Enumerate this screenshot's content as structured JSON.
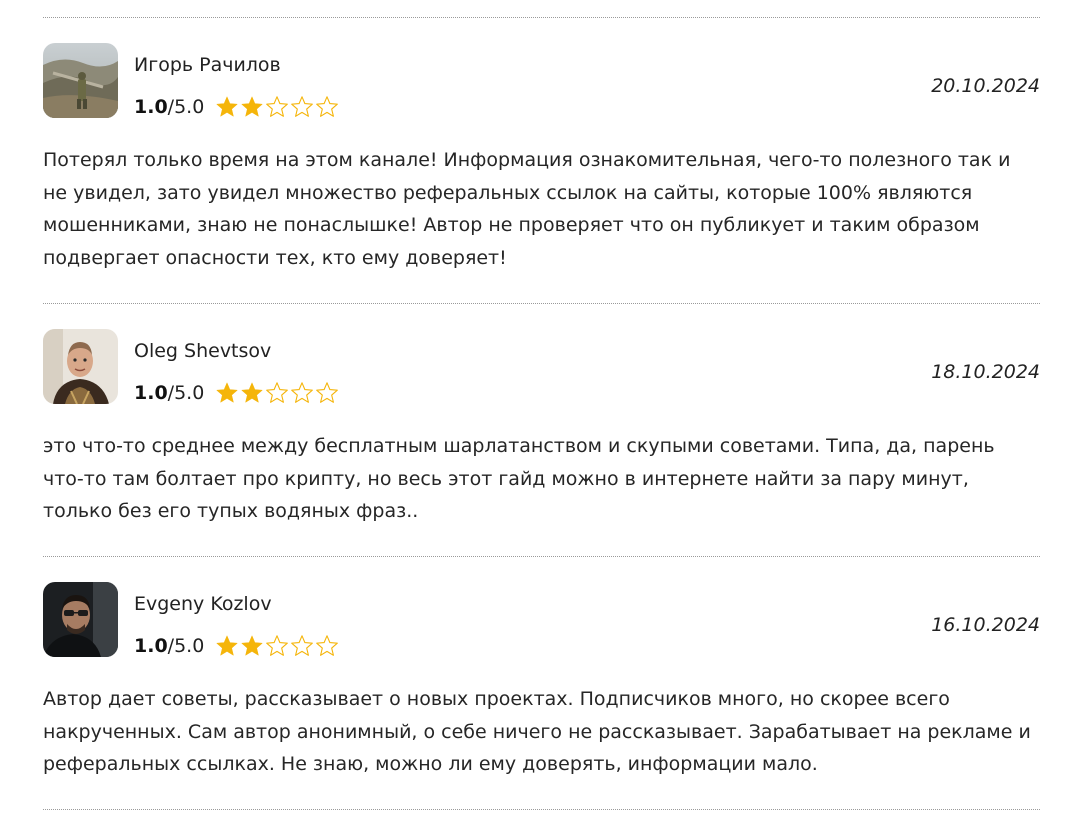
{
  "reviews": [
    {
      "avatar": "photo-person-in-field",
      "name": "Игорь Рачилов",
      "score": "1.0",
      "scale": "/5.0",
      "stars_filled": 2,
      "stars_total": 5,
      "date": "20.10.2024",
      "text": "Потерял только время на этом канале! Информация ознакомительная, чего-то полезного так и не увидел, зато увидел множество реферальных ссылок на сайты, которые 100% являются мошенниками, знаю не понаслышке! Автор не проверяет что он публикует и таким образом подвергает опасности тех, кто ему доверяет!"
    },
    {
      "avatar": "photo-man-portrait",
      "name": "Oleg Shevtsov",
      "score": "1.0",
      "scale": "/5.0",
      "stars_filled": 2,
      "stars_total": 5,
      "date": "18.10.2024",
      "text": "это что-то среднее между бесплатным шарлатанством и скупыми советами. Типа, да, парень что-то там болтает про крипту, но весь этот гайд можно в интернете найти за пару минут, только без его тупых водяных фраз.."
    },
    {
      "avatar": "photo-man-sunglasses",
      "name": "Evgeny Kozlov",
      "score": "1.0",
      "scale": "/5.0",
      "stars_filled": 2,
      "stars_total": 5,
      "date": "16.10.2024",
      "text": "Автор дает советы, рассказывает о новых проектах. Подписчиков много, но скорее всего накрученных. Сам автор анонимный, о себе ничего не рассказывает. Зарабатывает на рекламе и реферальных ссылках. Не знаю, можно ли ему доверять, информации мало."
    }
  ],
  "colors": {
    "star_filled": "#F5B50A",
    "star_empty_stroke": "#F5B50A",
    "divider": "#9A9A9A"
  }
}
